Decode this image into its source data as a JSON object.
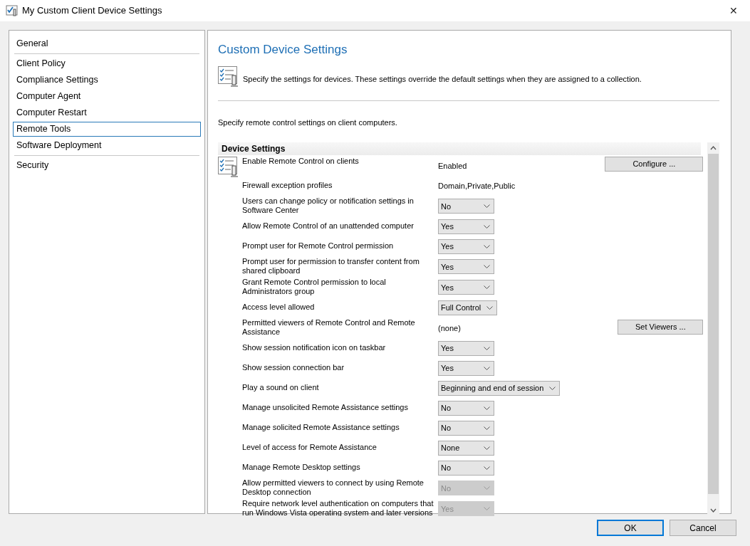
{
  "window": {
    "title": "My Custom Client Device Settings",
    "close": "✕"
  },
  "sidebar": {
    "groups": [
      [
        {
          "label": "General",
          "selected": false
        }
      ],
      [
        {
          "label": "Client Policy",
          "selected": false
        },
        {
          "label": "Compliance Settings",
          "selected": false
        },
        {
          "label": "Computer Agent",
          "selected": false
        },
        {
          "label": "Computer Restart",
          "selected": false
        },
        {
          "label": "Remote Tools",
          "selected": true
        },
        {
          "label": "Software Deployment",
          "selected": false
        }
      ],
      [
        {
          "label": "Security",
          "selected": false
        }
      ]
    ]
  },
  "content": {
    "title": "Custom Device Settings",
    "description": "Specify the settings for devices. These settings override the default settings when they are assigned to a collection.",
    "instruction": "Specify remote control settings on client computers.",
    "section_title": "Device Settings",
    "settings": [
      {
        "kind": "text",
        "label": "Enable Remote Control on clients",
        "value": "Enabled",
        "button": "Configure ..."
      },
      {
        "kind": "text",
        "label": "Firewall exception profiles",
        "value": "Domain,Private,Public"
      },
      {
        "kind": "dropdown",
        "label": "Users can change policy or notification settings in Software Center",
        "value": "No",
        "disabled": false
      },
      {
        "kind": "dropdown",
        "label": "Allow Remote Control of an unattended computer",
        "value": "Yes",
        "disabled": false
      },
      {
        "kind": "dropdown",
        "label": "Prompt user for Remote Control permission",
        "value": "Yes",
        "disabled": false
      },
      {
        "kind": "dropdown",
        "label": "Prompt user for permission to transfer content from shared clipboard",
        "value": "Yes",
        "disabled": false
      },
      {
        "kind": "dropdown",
        "label": "Grant Remote Control permission to local Administrators group",
        "value": "Yes",
        "disabled": false
      },
      {
        "kind": "dropdown",
        "label": "Access level allowed",
        "value": "Full Control",
        "disabled": false
      },
      {
        "kind": "text",
        "label": "Permitted viewers of Remote Control and Remote Assistance",
        "value": "(none)",
        "button": "Set Viewers ..."
      },
      {
        "kind": "dropdown",
        "label": "Show session notification icon on taskbar",
        "value": "Yes",
        "disabled": false
      },
      {
        "kind": "dropdown",
        "label": "Show session connection bar",
        "value": "Yes",
        "disabled": false
      },
      {
        "kind": "dropdown",
        "label": "Play a sound on client",
        "value": "Beginning and end of session",
        "disabled": false
      },
      {
        "kind": "dropdown",
        "label": "Manage unsolicited Remote Assistance settings",
        "value": "No",
        "disabled": false
      },
      {
        "kind": "dropdown",
        "label": "Manage solicited Remote Assistance settings",
        "value": "No",
        "disabled": false
      },
      {
        "kind": "dropdown",
        "label": "Level of access for Remote Assistance",
        "value": "None",
        "disabled": false
      },
      {
        "kind": "dropdown",
        "label": "Manage Remote Desktop settings",
        "value": "No",
        "disabled": false
      },
      {
        "kind": "dropdown",
        "label": "Allow permitted viewers to connect by using Remote Desktop connection",
        "value": "No",
        "disabled": true
      },
      {
        "kind": "dropdown",
        "label": "Require network level authentication on computers that run Windows Vista operating system and later versions",
        "value": "Yes",
        "disabled": true
      }
    ]
  },
  "buttons": [
    {
      "label": "OK",
      "default": true
    },
    {
      "label": "Cancel",
      "default": false
    }
  ]
}
